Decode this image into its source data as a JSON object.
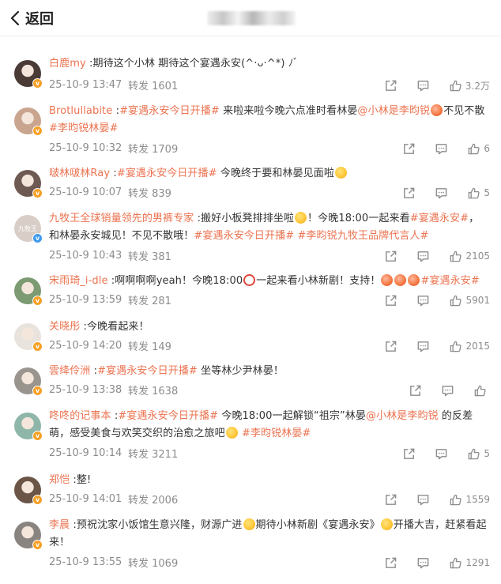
{
  "header": {
    "back_label": "返回"
  },
  "comments": [
    {
      "user": "白鹿my",
      "body": [
        {
          "t": "text",
          "v": " :期待这个小林 期待这个宴遇永安(^·ᴗ·^*) ﾉﾞ"
        }
      ],
      "date": "25-10-9 13:47",
      "repost": "转发 1601",
      "likes": "3.2万",
      "badge": "orange",
      "avatar_color": "#4a3b36"
    },
    {
      "user": "Brotlullabite",
      "body": [
        {
          "t": "text",
          "v": " :"
        },
        {
          "t": "tag",
          "v": "#宴遇永安今日开播#"
        },
        {
          "t": "text",
          "v": " 来啦来啦今晚六点准时看林晏"
        },
        {
          "t": "tag",
          "v": "@小林是李昀锐"
        },
        {
          "t": "emo",
          "v": "heart-face-emoji"
        },
        {
          "t": "text",
          "v": "不见不散"
        },
        {
          "t": "tag",
          "v": "#李昀锐林晏#"
        }
      ],
      "date": "25-10-9 10:32",
      "repost": "转发 1709",
      "likes": "6",
      "badge": "orange",
      "avatar_color": "#c9a58f"
    },
    {
      "user": "啵林啵林Ray",
      "body": [
        {
          "t": "text",
          "v": " :"
        },
        {
          "t": "tag",
          "v": "#宴遇永安今日开播#"
        },
        {
          "t": "text",
          "v": " 今晚终于要和林晏见面啦"
        },
        {
          "t": "emo",
          "v": "kiss-face-emoji"
        }
      ],
      "date": "25-10-9 10:07",
      "repost": "转发 839",
      "likes": "5",
      "badge": "orange",
      "avatar_color": "#6e5a52"
    },
    {
      "user": "九牧王全球销量领先的男裤专家",
      "body": [
        {
          "t": "text",
          "v": " :搬好小板凳排排坐啦"
        },
        {
          "t": "emo",
          "v": "excited-face-emoji"
        },
        {
          "t": "text",
          "v": "！今晚18:00一起来看"
        },
        {
          "t": "tag",
          "v": "#宴遇永安#"
        },
        {
          "t": "text",
          "v": "， 和林晏永安城见！不见不散哦！"
        },
        {
          "t": "tag",
          "v": "#宴遇永安今日开播#"
        },
        {
          "t": "text",
          "v": " "
        },
        {
          "t": "tag",
          "v": "#李昀锐九牧王品牌代言人#"
        }
      ],
      "date": "25-10-9 10:43",
      "repost": "转发 381",
      "likes": "2105",
      "badge": "blue",
      "avatar_color": "#d8cec7",
      "avatar_text": "九牧王"
    },
    {
      "user": "宋雨琦_i-dle",
      "body": [
        {
          "t": "text",
          "v": " :啊啊啊啊yeah！今晚18:00"
        },
        {
          "t": "emo",
          "v": "alarm-clock-emoji"
        },
        {
          "t": "text",
          "v": "一起来看小林新剧！支持！"
        },
        {
          "t": "emo",
          "v": "heart-face-emoji"
        },
        {
          "t": "emo",
          "v": "heart-face-emoji"
        },
        {
          "t": "emo",
          "v": "heart-face-emoji"
        },
        {
          "t": "tag",
          "v": "#宴遇永安#"
        }
      ],
      "date": "25-10-9 13:59",
      "repost": "转发 281",
      "likes": "5901",
      "badge": "orange",
      "avatar_color": "#7c9b72"
    },
    {
      "user": "关晓彤",
      "body": [
        {
          "t": "text",
          "v": " :今晚看起来！"
        }
      ],
      "date": "25-10-9 14:20",
      "repost": "转发 149",
      "likes": "2015",
      "badge": "orange",
      "avatar_color": "#e9e3dd"
    },
    {
      "user": "雲绛伶洲",
      "body": [
        {
          "t": "text",
          "v": " :"
        },
        {
          "t": "tag",
          "v": "#宴遇永安今日开播#"
        },
        {
          "t": "text",
          "v": " 坐等林少尹林晏！"
        }
      ],
      "date": "25-10-9 13:38",
      "repost": "转发 1638",
      "likes": "",
      "badge": "orange",
      "avatar_color": "#9a948e"
    },
    {
      "user": "咚咚的记事本",
      "body": [
        {
          "t": "text",
          "v": " :"
        },
        {
          "t": "tag",
          "v": "#宴遇永安今日开播#"
        },
        {
          "t": "text",
          "v": " 今晚18:00一起解锁“祖宗”林晏"
        },
        {
          "t": "tag",
          "v": "@小林是李昀锐"
        },
        {
          "t": "text",
          "v": " 的反差萌，感受美食与欢笑交织的治愈之旅吧"
        },
        {
          "t": "emo",
          "v": "laugh-face-emoji"
        },
        {
          "t": "text",
          "v": " "
        },
        {
          "t": "tag",
          "v": "#李昀锐林晏#"
        }
      ],
      "date": "25-10-9 10:14",
      "repost": "转发 3211",
      "likes": "5",
      "badge": "orange",
      "avatar_color": "#8fb7a9"
    },
    {
      "user": "郑恺",
      "body": [
        {
          "t": "text",
          "v": " :整!"
        }
      ],
      "date": "25-10-9 14:01",
      "repost": "转发 2006",
      "likes": "1559",
      "badge": "orange",
      "avatar_color": "#6b5547"
    },
    {
      "user": "李晨",
      "body": [
        {
          "t": "text",
          "v": " :预祝沈家小饭馆生意兴隆，财源广进"
        },
        {
          "t": "emo",
          "v": "grin-face-emoji"
        },
        {
          "t": "text",
          "v": "期待小林新剧《宴遇永安》"
        },
        {
          "t": "emo",
          "v": "grin-face-emoji"
        },
        {
          "t": "text",
          "v": "开播大吉，赶紧看起来！"
        }
      ],
      "date": "25-10-9 13:55",
      "repost": "转发 1069",
      "likes": "1291",
      "badge": "orange",
      "avatar_color": "#8a8480"
    }
  ]
}
